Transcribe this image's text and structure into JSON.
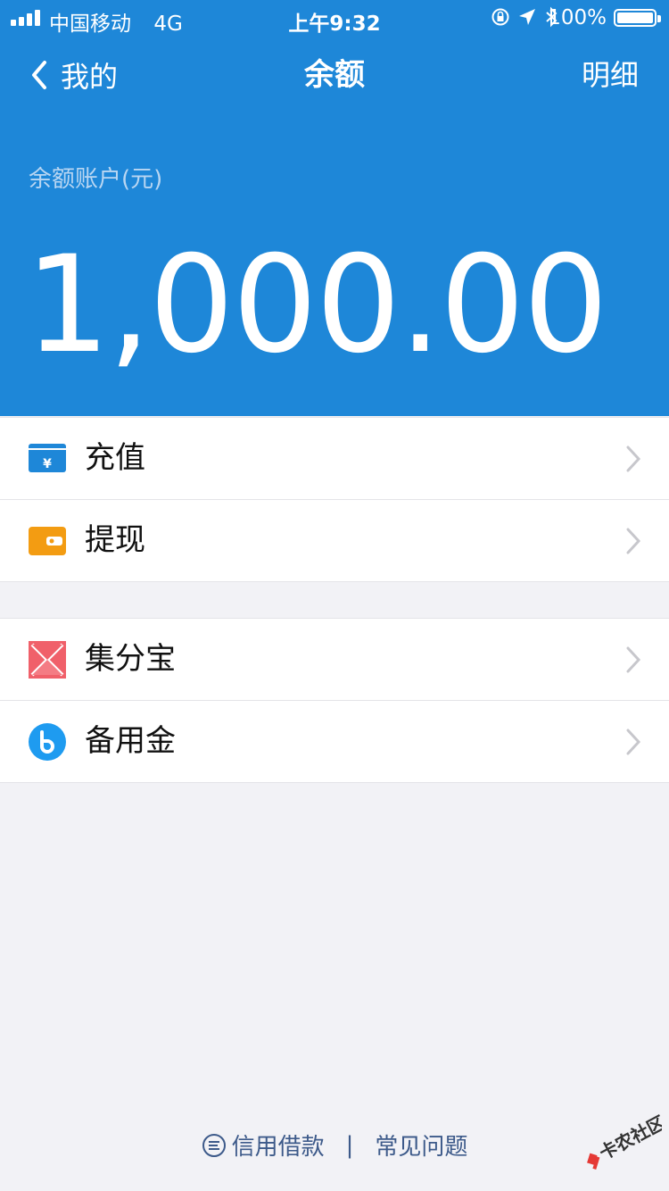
{
  "status_bar": {
    "carrier": "中国移动",
    "network": "4G",
    "time": "上午9:32",
    "battery": "100%"
  },
  "nav": {
    "back_label": "我的",
    "title": "余额",
    "detail_label": "明细"
  },
  "balance": {
    "label": "余额账户(元)",
    "value": "1,000.00"
  },
  "group1": [
    {
      "label": "充值",
      "icon": "recharge-card-icon"
    },
    {
      "label": "提现",
      "icon": "wallet-withdraw-icon"
    }
  ],
  "group2": [
    {
      "label": "集分宝",
      "icon": "jifenbao-icon"
    },
    {
      "label": "备用金",
      "icon": "reserve-fund-icon"
    }
  ],
  "footer": {
    "credit_loan": "信用借款",
    "separator": "|",
    "faq": "常见问题"
  },
  "watermark": {
    "text": "卡农社区"
  },
  "colors": {
    "header_blue": "#1e87d8",
    "recharge_icon": "#1e87d8",
    "withdraw_icon": "#f39c12",
    "jifenbao_icon": "#f0606a",
    "reserve_icon": "#1e9bf0",
    "footer_text": "#3d5a8a"
  }
}
